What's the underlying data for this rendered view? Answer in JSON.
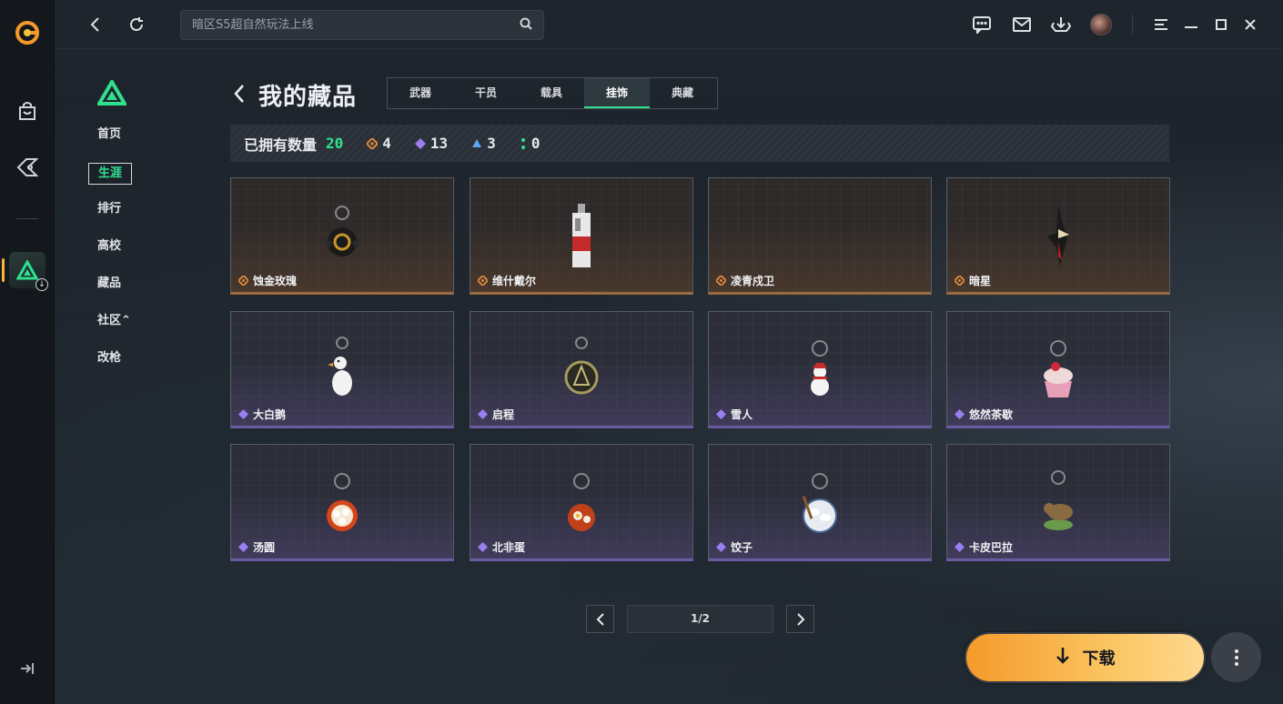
{
  "colors": {
    "accent_green": "#2fe08f",
    "gold_quality": "#e08a3a",
    "purple_quality": "#9a7ff0",
    "blue_quality": "#5aa8f0",
    "green_quality": "#2fe08f",
    "download_gradient": [
      "#f59a2a",
      "#fdd990"
    ]
  },
  "topbar": {
    "search_placeholder": "暗区S5超自然玩法上线",
    "icons": [
      "back-icon",
      "refresh-icon",
      "search-icon",
      "chat-icon",
      "mail-icon",
      "download-manager-icon",
      "avatar",
      "menu-icon",
      "minimize-icon",
      "maximize-icon",
      "close-icon"
    ]
  },
  "rail": {
    "icons": [
      "app-logo-icon",
      "store-bag-icon",
      "games-icon",
      "game-tile-icon",
      "collapse-icon"
    ]
  },
  "nav": {
    "items": [
      {
        "label": "首页",
        "active": false
      },
      {
        "label": "生涯",
        "active": true
      },
      {
        "label": "排行",
        "active": false
      },
      {
        "label": "高校",
        "active": false
      },
      {
        "label": "藏品",
        "active": false
      },
      {
        "label": "社区⌃",
        "active": false
      },
      {
        "label": "改枪",
        "active": false
      }
    ]
  },
  "header": {
    "title": "我的藏品",
    "tabs": [
      {
        "label": "武器",
        "active": false
      },
      {
        "label": "干员",
        "active": false
      },
      {
        "label": "载具",
        "active": false
      },
      {
        "label": "挂饰",
        "active": true
      },
      {
        "label": "典藏",
        "active": false
      }
    ]
  },
  "stats": {
    "label": "已拥有数量",
    "total": "20",
    "counts": [
      {
        "quality": "gold",
        "value": "4"
      },
      {
        "quality": "purple",
        "value": "13"
      },
      {
        "quality": "blue",
        "value": "3"
      },
      {
        "quality": "green",
        "value": "0"
      }
    ]
  },
  "items": [
    {
      "name": "蚀金玫瑰",
      "quality": "gold"
    },
    {
      "name": "维什戴尔",
      "quality": "gold"
    },
    {
      "name": "凌青戍卫",
      "quality": "gold"
    },
    {
      "name": "暗星",
      "quality": "gold"
    },
    {
      "name": "大白鹅",
      "quality": "purple"
    },
    {
      "name": "启程",
      "quality": "purple"
    },
    {
      "name": "雪人",
      "quality": "purple"
    },
    {
      "name": "悠然茶歇",
      "quality": "purple"
    },
    {
      "name": "汤圆",
      "quality": "purple"
    },
    {
      "name": "北非蛋",
      "quality": "purple"
    },
    {
      "name": "饺子",
      "quality": "purple"
    },
    {
      "name": "卡皮巴拉",
      "quality": "purple"
    }
  ],
  "pager": {
    "text": "1/2"
  },
  "download_button": {
    "label": "下载"
  }
}
